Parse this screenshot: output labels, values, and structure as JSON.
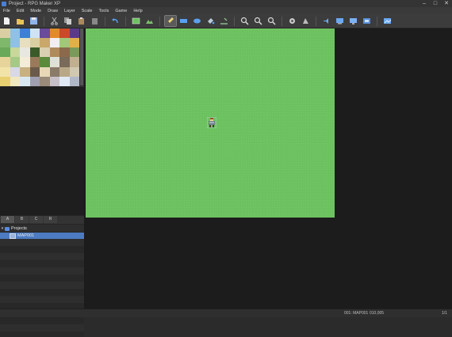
{
  "window": {
    "title": "Project - RPG Maker XP"
  },
  "menu": [
    "File",
    "Edit",
    "Mode",
    "Draw",
    "Layer",
    "Scale",
    "Tools",
    "Game",
    "Help"
  ],
  "toolbar": {
    "icons": [
      "new-project",
      "open-project",
      "save-project",
      "cut",
      "copy",
      "paste",
      "delete",
      "undo",
      "layer-1",
      "layer-2",
      "layer-3",
      "events",
      "pencil",
      "rectangle",
      "ellipse",
      "fill",
      "select",
      "zoom-1",
      "zoom-2",
      "zoom-4",
      "database",
      "material-base",
      "script-editor",
      "sound-test",
      "playtest"
    ],
    "active": "pencil"
  },
  "left_tabs": [
    "A",
    "B",
    "C",
    "R"
  ],
  "tree": {
    "root": "Projects",
    "items": [
      "MAP001"
    ]
  },
  "status": {
    "map_info": "001: MAP001",
    "coords": "010,005",
    "zoom": "1/1"
  },
  "colors": {
    "grass": "#6dc260",
    "selection": "#4c7bc2",
    "toolbar_bg": "#3c3c3c"
  }
}
